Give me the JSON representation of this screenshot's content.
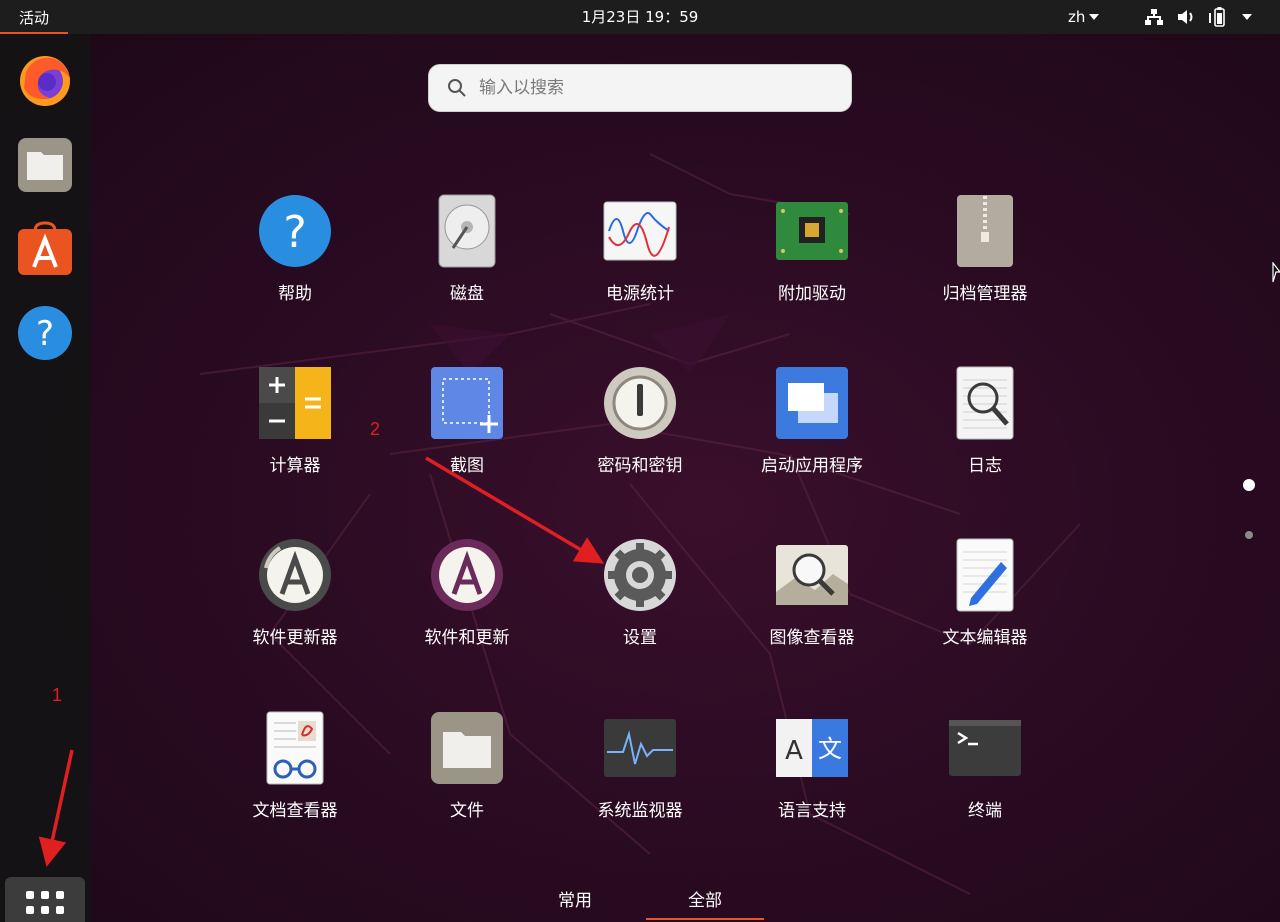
{
  "topbar": {
    "activities": "活动",
    "clock": "1月23日  19：59",
    "lang": "zh"
  },
  "search": {
    "placeholder": "输入以搜索"
  },
  "apps": [
    {
      "label": "帮助",
      "icon": "help-icon"
    },
    {
      "label": "磁盘",
      "icon": "disk-icon"
    },
    {
      "label": "电源统计",
      "icon": "power-statistics-icon"
    },
    {
      "label": "附加驱动",
      "icon": "additional-drivers-icon"
    },
    {
      "label": "归档管理器",
      "icon": "archive-manager-icon"
    },
    {
      "label": "计算器",
      "icon": "calculator-icon"
    },
    {
      "label": "截图",
      "icon": "screenshot-icon"
    },
    {
      "label": "密码和密钥",
      "icon": "passwords-keys-icon"
    },
    {
      "label": "启动应用程序",
      "icon": "startup-applications-icon"
    },
    {
      "label": "日志",
      "icon": "logs-icon"
    },
    {
      "label": "软件更新器",
      "icon": "software-updater-icon"
    },
    {
      "label": "软件和更新",
      "icon": "software-updates-icon"
    },
    {
      "label": "设置",
      "icon": "settings-gear-icon"
    },
    {
      "label": "图像查看器",
      "icon": "image-viewer-icon"
    },
    {
      "label": "文本编辑器",
      "icon": "text-editor-icon"
    },
    {
      "label": "文档查看器",
      "icon": "document-viewer-icon"
    },
    {
      "label": "文件",
      "icon": "files-folder-icon"
    },
    {
      "label": "系统监视器",
      "icon": "system-monitor-icon"
    },
    {
      "label": "语言支持",
      "icon": "language-support-icon"
    },
    {
      "label": "终端",
      "icon": "terminal-icon"
    }
  ],
  "tabs": {
    "frequent": "常用",
    "all": "全部"
  },
  "annotations": {
    "one": "1",
    "two": "2"
  },
  "colors": {
    "accent": "#e95420",
    "annotation": "#e02020"
  }
}
